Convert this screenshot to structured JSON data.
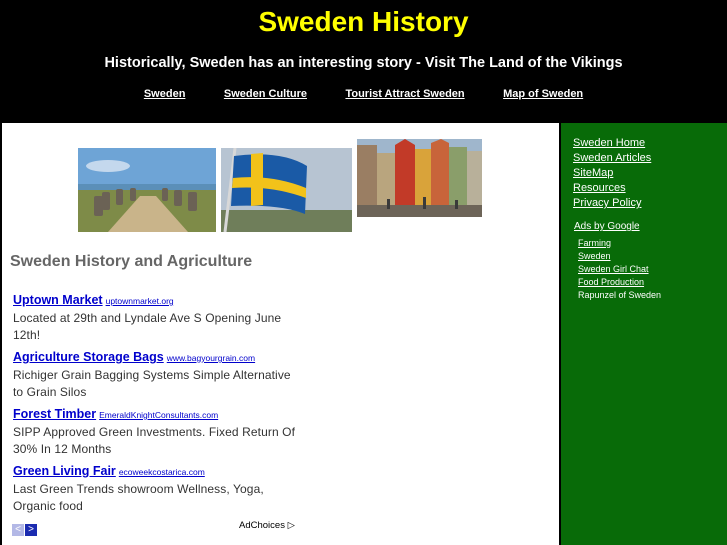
{
  "header": {
    "title": "Sweden History",
    "tagline": "Historically, Sweden has an interesting story - Visit The Land of the Vikings",
    "nav": [
      "Sweden",
      "Sweden Culture",
      "Tourist Attract Sweden",
      "Map of Sweden"
    ]
  },
  "main": {
    "heading": "Sweden History and Agriculture",
    "ads": [
      {
        "title": "Uptown Market",
        "url": "uptownmarket.org",
        "desc": "Located at 29th and Lyndale Ave S Opening June 12th!"
      },
      {
        "title": "Agriculture Storage Bags",
        "url": "www.bagyourgrain.com",
        "desc": "Richiger Grain Bagging Systems Simple Alternative to Grain Silos"
      },
      {
        "title": "Forest Timber",
        "url": "EmeraldKnightConsultants.com",
        "desc": "SIPP Approved Green Investments. Fixed Return Of 30% In 12 Months"
      },
      {
        "title": "Green Living Fair",
        "url": "ecoweekcostarica.com",
        "desc": "Last Green Trends showroom Wellness, Yoga, Organic food"
      }
    ],
    "prev_glyph": "<",
    "next_glyph": ">",
    "adchoices": "AdChoices ▷"
  },
  "sidebar": {
    "links": [
      "Sweden Home",
      "Sweden Articles",
      "SiteMap",
      "Resources",
      "Privacy Policy"
    ],
    "ads_by": "Ads by Google",
    "ads": [
      "Farming",
      "Sweden",
      "Sweden Girl Chat",
      "Food Production",
      "Rapunzel of Sweden"
    ]
  },
  "colors": {
    "header_bg": "#000000",
    "title": "#ffff00",
    "sidebar_bg": "#086b08",
    "ad_link": "#0000cc"
  }
}
